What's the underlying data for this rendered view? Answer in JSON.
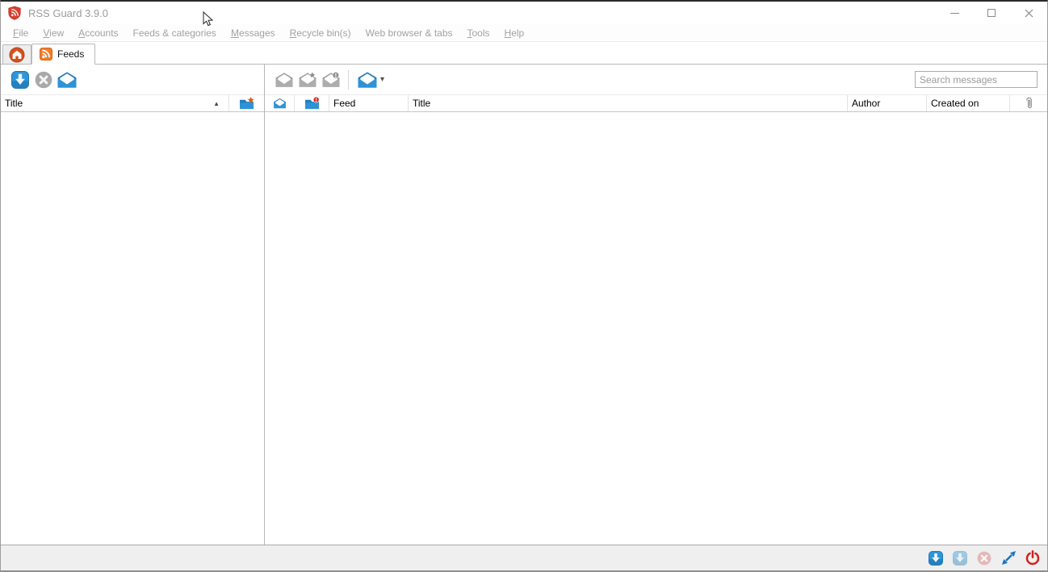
{
  "titlebar": {
    "title": "RSS Guard 3.9.0"
  },
  "menu": {
    "items": [
      {
        "label": "File"
      },
      {
        "label": "View"
      },
      {
        "label": "Accounts"
      },
      {
        "label": "Feeds & categories"
      },
      {
        "label": "Messages"
      },
      {
        "label": "Recycle bin(s)"
      },
      {
        "label": "Web browser & tabs"
      },
      {
        "label": "Tools"
      },
      {
        "label": "Help"
      }
    ]
  },
  "tabs": {
    "feeds_label": "Feeds"
  },
  "feeds_pane": {
    "header": {
      "title_column": "Title"
    }
  },
  "messages_pane": {
    "search": {
      "placeholder": "Search messages"
    },
    "header": {
      "feed_column": "Feed",
      "title_column": "Title",
      "author_column": "Author",
      "created_on_column": "Created on"
    }
  },
  "icons": {
    "sort_ascending": "▲",
    "dropdown_caret": "▾"
  },
  "colors": {
    "accent_blue": "#2e93d6",
    "brand_orange": "#ee7f2b",
    "danger_red": "#ce231e",
    "disabled_gray": "#a9a9a9"
  }
}
